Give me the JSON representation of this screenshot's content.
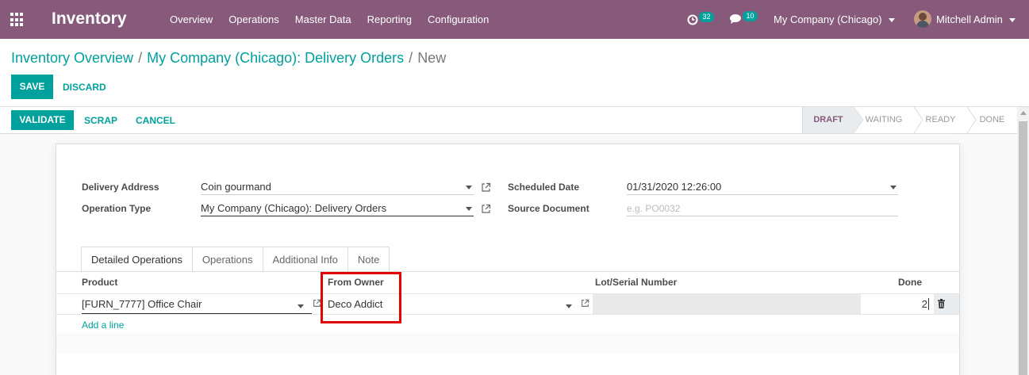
{
  "navbar": {
    "brand": "Inventory",
    "menu": [
      "Overview",
      "Operations",
      "Master Data",
      "Reporting",
      "Configuration"
    ],
    "activity_count": "32",
    "message_count": "10",
    "company": "My Company (Chicago)",
    "user": "Mitchell Admin",
    "colors": {
      "bar": "#875a7b",
      "badge": "#00a09d"
    }
  },
  "breadcrumb": {
    "items": [
      "Inventory Overview",
      "My Company (Chicago): Delivery Orders"
    ],
    "separator": "/",
    "current": "New"
  },
  "actions": {
    "save": "SAVE",
    "discard": "DISCARD"
  },
  "statusbar": {
    "buttons": {
      "validate": "VALIDATE",
      "scrap": "SCRAP",
      "cancel": "CANCEL"
    },
    "states": [
      "DRAFT",
      "WAITING",
      "READY",
      "DONE"
    ],
    "active_state": "DRAFT"
  },
  "form": {
    "delivery_address_label": "Delivery Address",
    "delivery_address_value": "Coin gourmand",
    "operation_type_label": "Operation Type",
    "operation_type_value": "My Company (Chicago): Delivery Orders",
    "scheduled_date_label": "Scheduled Date",
    "scheduled_date_value": "01/31/2020 12:26:00",
    "source_document_label": "Source Document",
    "source_document_placeholder": "e.g. PO0032"
  },
  "tabs": [
    "Detailed Operations",
    "Operations",
    "Additional Info",
    "Note"
  ],
  "table": {
    "columns": {
      "product": "Product",
      "from_owner": "From Owner",
      "lot": "Lot/Serial Number",
      "done": "Done"
    },
    "rows": [
      {
        "product": "[FURN_7777] Office Chair",
        "from_owner": "Deco Addict",
        "lot": "",
        "done": "2"
      }
    ],
    "add_line": "Add a line"
  },
  "highlight_color": "#e00000"
}
